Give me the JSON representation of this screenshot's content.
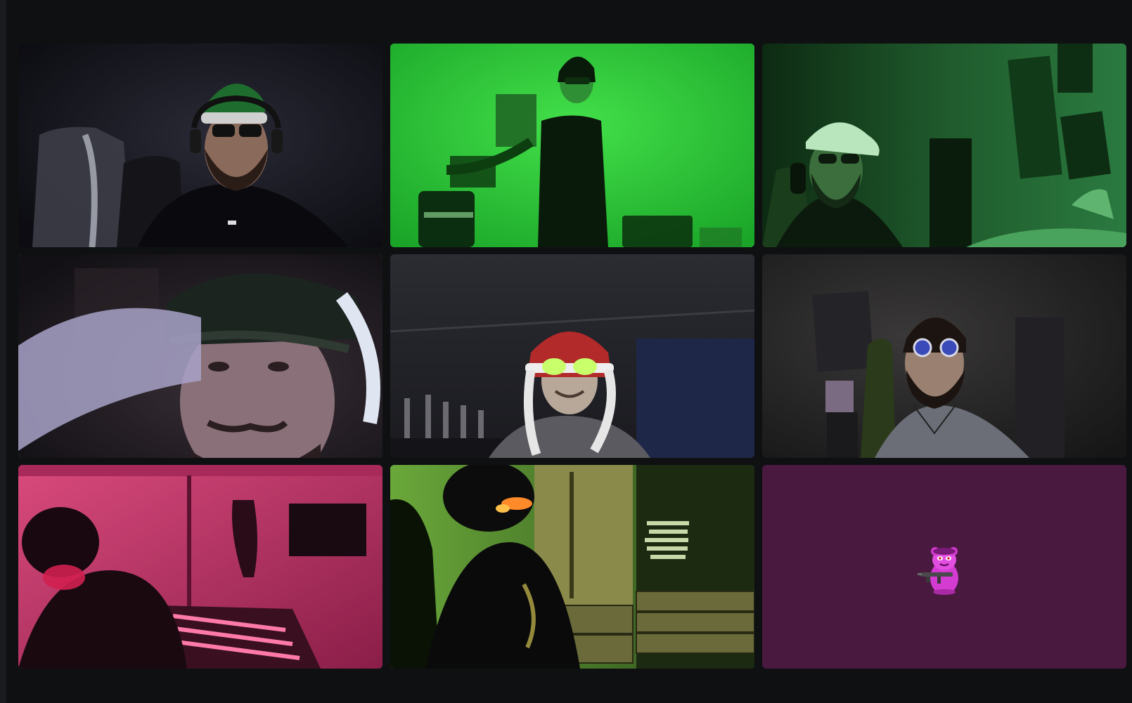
{
  "colors": {
    "background": "#0f1012",
    "speaking_ring": "#43b581",
    "empty_tile": "#4a1940"
  },
  "tiles": [
    {
      "name": "",
      "speaking": false,
      "video": true
    },
    {
      "name": "",
      "speaking": true,
      "video": true
    },
    {
      "name": "",
      "speaking": false,
      "video": true
    },
    {
      "name": "",
      "speaking": true,
      "video": true
    },
    {
      "name": "",
      "speaking": false,
      "video": true
    },
    {
      "name": "",
      "speaking": false,
      "video": true
    },
    {
      "name": "",
      "speaking": false,
      "video": true
    },
    {
      "name": "",
      "speaking": true,
      "video": true
    },
    {
      "name": "",
      "speaking": false,
      "video": false,
      "avatar_icon": "pink-bear-with-rifle-icon"
    }
  ]
}
